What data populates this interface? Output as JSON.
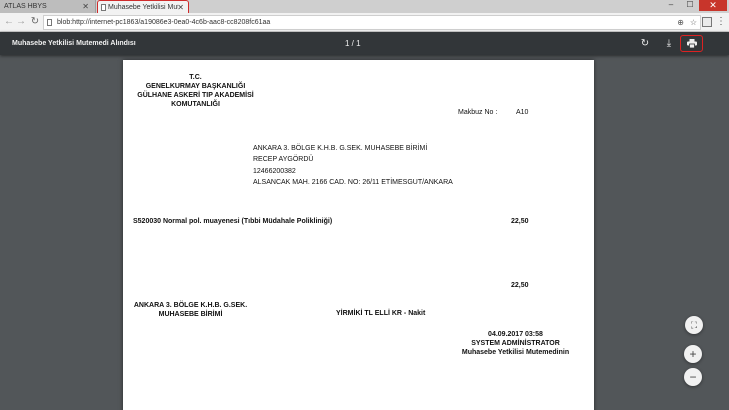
{
  "browser": {
    "tabs": [
      {
        "label": "ATLAS HBYS"
      },
      {
        "label": "Muhasebe Yetkilisi Mutemedi Alındısı"
      }
    ],
    "url": "blob:http://internet-pc1863/a19086e3-0ea0-4c6b-aac8-cc8208fc61aa"
  },
  "pdf_viewer": {
    "title": "Muhasebe Yetkilisi Mutemedi Alındısı",
    "page_indicator": "1 / 1"
  },
  "document": {
    "header_lines": [
      "T.C.",
      "GENELKURMAY BAŞKANLIĞI",
      "GÜLHANE ASKERİ TIP AKADEMİSİ",
      "KOMUTANLIĞI"
    ],
    "receipt_label": "Makbuz No :",
    "receipt_no": "A10",
    "recipient_lines": [
      "ANKARA 3. BÖLGE K.H.B. G.SEK. MUHASEBE BİRİMİ",
      "RECEP AYGÖRDÜ",
      "12466200382",
      "ALSANCAK MAH. 2166 CAD. NO: 26/11 ETİMESGUT/ANKARA"
    ],
    "line_item": {
      "description": "S520030 Normal pol. muayenesi (Tıbbi Müdahale Polikliniği)",
      "amount": "22,50"
    },
    "total": "22,50",
    "issuer_lines": [
      "ANKARA 3. BÖLGE K.H.B. G.SEK.",
      "MUHASEBE BİRİMİ"
    ],
    "amount_in_words": "YİRMİKİ TL ELLİ KR - Nakit",
    "signature_lines": [
      "04.09.2017 03:58",
      "SYSTEM ADMİNİSTRATOR",
      "Muhasebe Yetkilisi Mutemedinin"
    ]
  }
}
